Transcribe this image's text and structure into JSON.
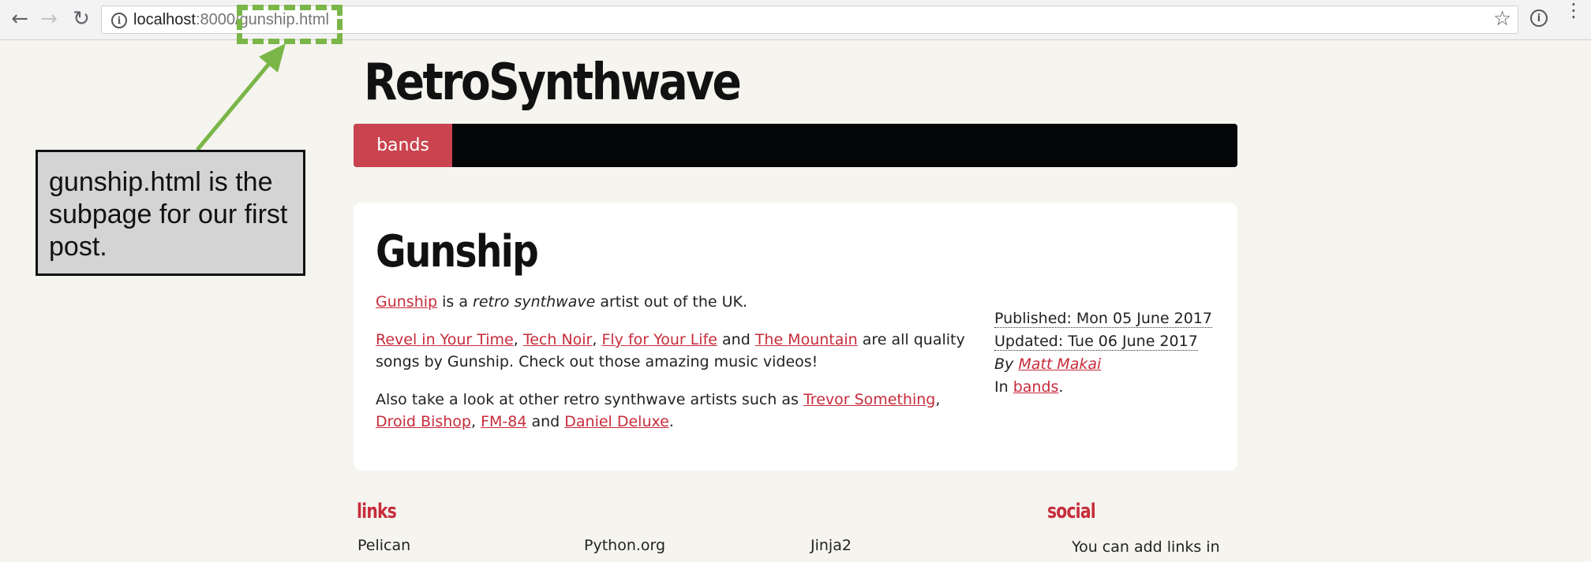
{
  "browser": {
    "back_icon": "←",
    "forward_icon": "→",
    "reload_icon": "↻",
    "url_host": "localhost",
    "url_path": ":8000/gunship.html",
    "info_icon": "i",
    "star_icon": "☆",
    "extension_icon": "i",
    "menu_icon": "⋮",
    "icons": [
      "back-icon",
      "forward-icon",
      "reload-icon",
      "info-icon",
      "star-icon",
      "extension-icon",
      "menu-icon"
    ]
  },
  "annotation": {
    "note": "gunship.html is the subpage for our first post.",
    "color": "#7ab648"
  },
  "site": {
    "title": "RetroSynthwave",
    "nav": [
      "bands"
    ],
    "accent": "#c9444f"
  },
  "post": {
    "title": "Gunship",
    "p1_link": "Gunship",
    "p1_a": " is a ",
    "p1_em": "retro synthwave",
    "p1_b": " artist out of the UK.",
    "p2_l1": "Revel in Your Time",
    "p2_l2": "Tech Noir",
    "p2_l3": "Fly for Your Life",
    "p2_l4": "The Mountain",
    "p2_and": " and ",
    "p2_tail": " are all quality songs by Gunship. Check out those amazing music videos!",
    "p3_a": "Also take a look at other retro synthwave artists such as ",
    "p3_l1": "Trevor Something",
    "p3_l2": "Droid Bishop",
    "p3_l3": "FM-84",
    "p3_and": " and ",
    "p3_l4": "Daniel Deluxe",
    "meta": {
      "published": "Published: Mon 05 June 2017",
      "updated": "Updated: Tue 06 June 2017",
      "by": "By",
      "author": "Matt Makai",
      "in": "In",
      "category": "bands"
    }
  },
  "footer": {
    "links_heading": "links",
    "links": [
      "Pelican",
      "Python.org",
      "Jinja2"
    ],
    "social_heading": "social",
    "social_text": "You can add links in"
  }
}
